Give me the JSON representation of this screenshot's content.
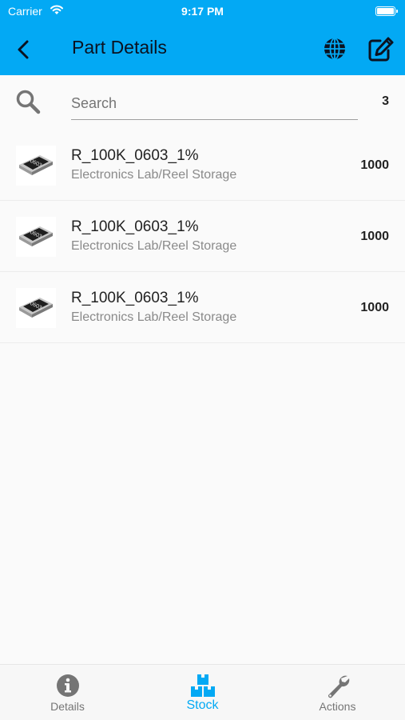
{
  "status_bar": {
    "carrier": "Carrier",
    "time": "9:17 PM"
  },
  "app_bar": {
    "title": "Part Details"
  },
  "search": {
    "placeholder": "Search",
    "value": "",
    "count": "3"
  },
  "stock_items": [
    {
      "name": "R_100K_0603_1%",
      "location": "Electronics Lab/Reel Storage",
      "quantity": "1000"
    },
    {
      "name": "R_100K_0603_1%",
      "location": "Electronics Lab/Reel Storage",
      "quantity": "1000"
    },
    {
      "name": "R_100K_0603_1%",
      "location": "Electronics Lab/Reel Storage",
      "quantity": "1000"
    }
  ],
  "bottom_nav": {
    "items": [
      {
        "label": "Details",
        "icon": "info-icon"
      },
      {
        "label": "Stock",
        "icon": "boxes-icon",
        "active": true
      },
      {
        "label": "Actions",
        "icon": "wrench-icon"
      }
    ]
  },
  "colors": {
    "accent": "#03a9f4",
    "text": "#222222",
    "secondary_text": "#8a8a8a",
    "inactive_nav": "#757575"
  }
}
